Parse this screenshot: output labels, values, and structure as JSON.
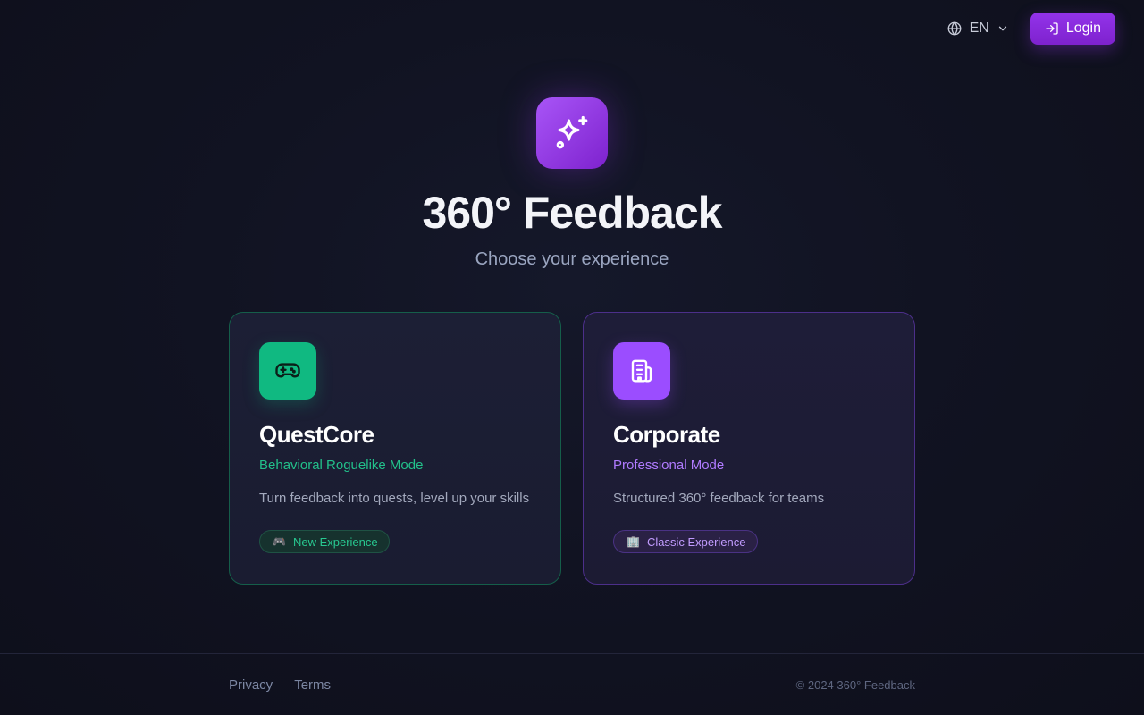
{
  "header": {
    "language": "EN",
    "login_label": "Login"
  },
  "hero": {
    "title": "360° Feedback",
    "subtitle": "Choose your experience"
  },
  "cards": [
    {
      "title": "QuestCore",
      "mode": "Behavioral Roguelike Mode",
      "description": "Turn feedback into quests, level up your skills",
      "badge_icon": "🎮",
      "badge_label": "New Experience",
      "icon": "gamepad-icon",
      "accent": "#10b981"
    },
    {
      "title": "Corporate",
      "mode": "Professional Mode",
      "description": "Structured 360° feedback for teams",
      "badge_icon": "🏢",
      "badge_label": "Classic Experience",
      "icon": "building-icon",
      "accent": "#9b4dff"
    }
  ],
  "footer": {
    "privacy": "Privacy",
    "terms": "Terms",
    "copyright": "© 2024 360° Feedback"
  }
}
